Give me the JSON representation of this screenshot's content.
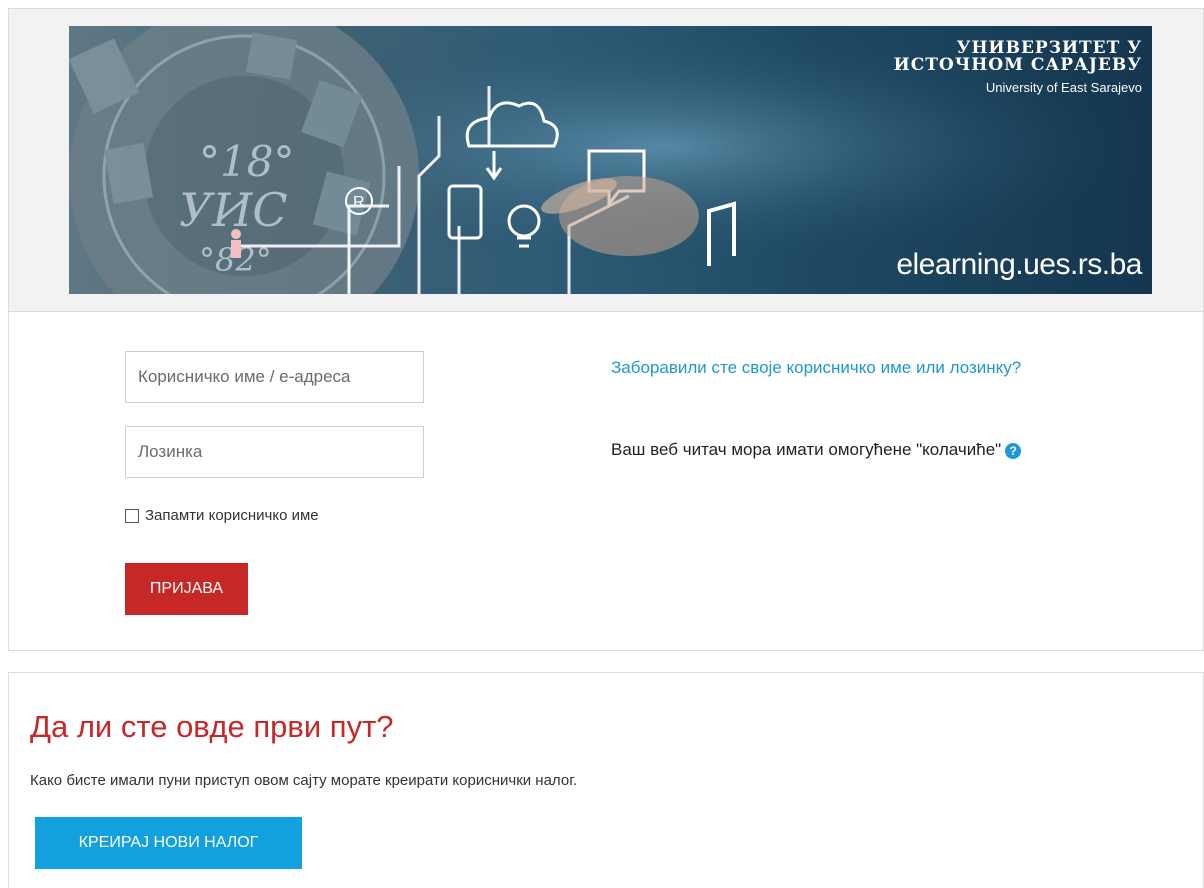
{
  "banner": {
    "university_line1": "УНИВЕРЗИТЕТ У",
    "university_line2": "ИСТОЧНОМ САРАЈЕВУ",
    "university_latin": "University of East Sarajevo",
    "site_url": "elearning.ues.rs.ba",
    "seal_text": "°18° УИС °82°"
  },
  "login": {
    "username_placeholder": "Корисничко име / е-адреса",
    "password_placeholder": "Лозинка",
    "remember_label": "Запамти корисничко име",
    "login_button": "ПРИЈАВА",
    "forgot_link": "Заборавили сте своје корисничко име или лозинку?",
    "cookies_notice": "Ваш веб читач мора имати омогућене \"колачиће\""
  },
  "signup": {
    "heading": "Да ли сте овде први пут?",
    "text": "Како бисте имали пуни приступ овом сајту морате креирати кориснички налог.",
    "create_button": "КРЕИРАЈ НОВИ НАЛОГ"
  },
  "colors": {
    "brand_red": "#c62828",
    "link_blue": "#1e98d3",
    "create_button_blue": "#12a0de"
  },
  "icons": {
    "help": "question-circle-icon"
  }
}
